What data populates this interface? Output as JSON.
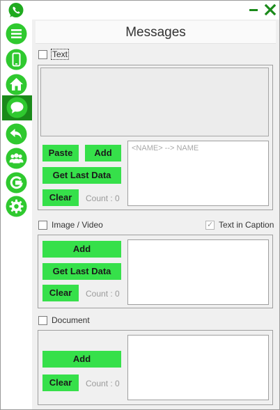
{
  "window": {
    "icons": {
      "app": "whatsapp-icon",
      "minimize": "minimize-icon",
      "close": "close-icon"
    },
    "colors": {
      "accent": "#1a8a1a",
      "button": "#36e04a",
      "nav_icon": "#2fc92f"
    }
  },
  "sidebar": {
    "items": [
      {
        "icon": "menu-icon"
      },
      {
        "icon": "phone-icon"
      },
      {
        "icon": "home-icon"
      },
      {
        "icon": "chat-icon",
        "active": true
      },
      {
        "icon": "reply-icon"
      },
      {
        "icon": "contacts-icon"
      },
      {
        "icon": "google-icon"
      },
      {
        "icon": "settings-icon"
      }
    ]
  },
  "page": {
    "title": "Messages"
  },
  "text_section": {
    "checkbox_label": "Text",
    "checked": false,
    "paste_label": "Paste",
    "add_label": "Add",
    "get_last_data_label": "Get Last Data",
    "clear_label": "Clear",
    "count_text": "Count : 0",
    "names_placeholder": "<NAME> --> NAME"
  },
  "image_section": {
    "checkbox_label": "Image / Video",
    "checked": false,
    "caption_label": "Text in Caption",
    "caption_checked": true,
    "add_label": "Add",
    "get_last_data_label": "Get Last Data",
    "clear_label": "Clear",
    "count_text": "Count : 0"
  },
  "document_section": {
    "checkbox_label": "Document",
    "checked": false,
    "add_label": "Add",
    "clear_label": "Clear",
    "count_text": "Count : 0"
  }
}
